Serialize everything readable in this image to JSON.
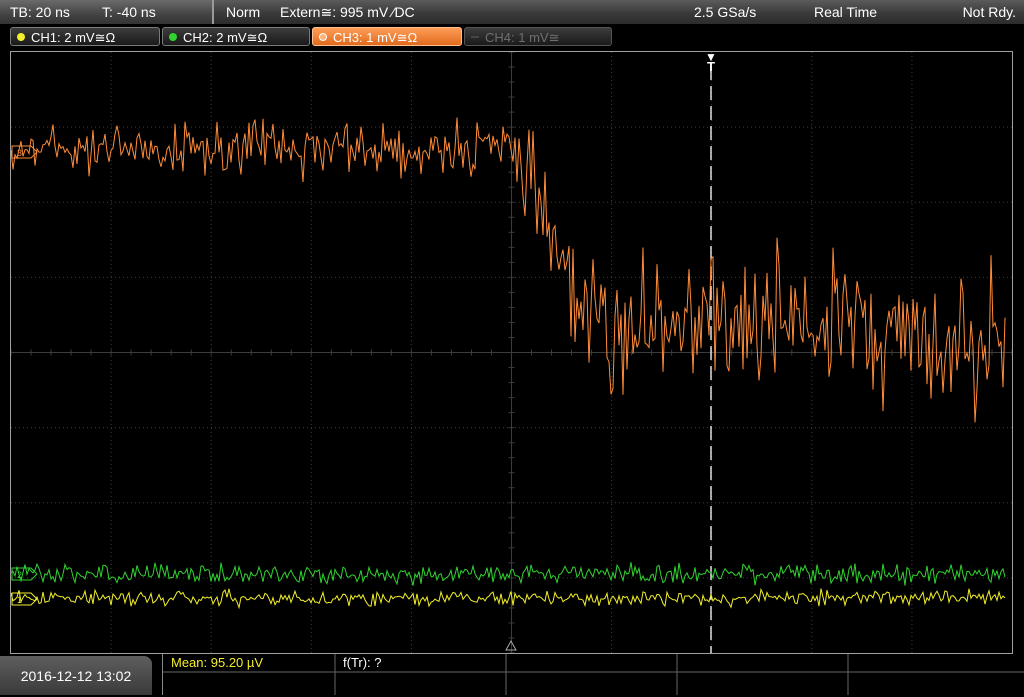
{
  "status_bar": {
    "timebase": "TB: 20 ns",
    "trigger_time": "T: -40 ns",
    "trigger_mode": "Norm",
    "trigger_source": "Extern≅: 995 mV ⁄DC",
    "sample_rate": "2.5 GSa/s",
    "acquisition_mode": "Real Time",
    "status": "Not Rdy."
  },
  "channels": [
    {
      "label": "CH1: 2 mV≅Ω",
      "color": "#f2ef2a"
    },
    {
      "label": "CH2: 2 mV≅Ω",
      "color": "#31d431"
    },
    {
      "label": "CH3: 1 mV≅Ω",
      "color": "#ff8c3a",
      "active": true
    },
    {
      "label": "CH4: 1 mV≅",
      "color": "#6f6f6f"
    }
  ],
  "markers": {
    "trigger_marker": "T",
    "ground_ch3": "3",
    "ground_ch1": "1",
    "ground_ch2": "2"
  },
  "bottom_bar": {
    "datetime": "2016-12-12 13:02",
    "mean": "Mean: 95.20 µV",
    "ftr": "f(Tr): ?"
  },
  "colors": {
    "ch1": "#f2ef2a",
    "ch2": "#31d431",
    "ch3": "#ff8c3a",
    "grid": "#3c3c3c",
    "background": "#000000"
  }
}
